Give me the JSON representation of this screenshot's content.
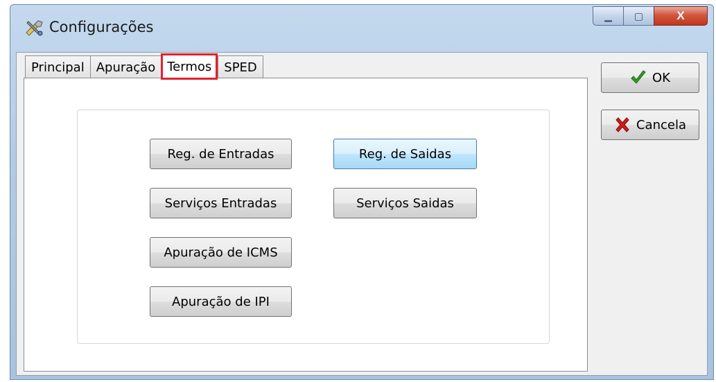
{
  "window": {
    "title": "Configurações",
    "icon": "settings-tools-icon",
    "minimize_glyph": "▁",
    "maximize_glyph": "▢",
    "close_glyph": "X"
  },
  "tabs": [
    {
      "label": "Principal"
    },
    {
      "label": "Apuração"
    },
    {
      "label": "Termos",
      "active": true
    },
    {
      "label": "SPED"
    }
  ],
  "termos": {
    "reg_entradas": "Reg. de Entradas",
    "reg_saidas": "Reg. de Saidas",
    "servicos_entradas": "Serviços Entradas",
    "servicos_saidas": "Serviços Saidas",
    "apuracao_icms": "Apuração de ICMS",
    "apuracao_ipi": "Apuração de IPI"
  },
  "actions": {
    "ok_label": "OK",
    "ok_icon": "checkmark-icon",
    "cancel_label": "Cancela",
    "cancel_icon": "x-cross-icon"
  },
  "colors": {
    "active_tab_highlight": "#e0222e",
    "ok_icon": "#2e9e1f",
    "cancel_icon": "#d11b1b"
  }
}
